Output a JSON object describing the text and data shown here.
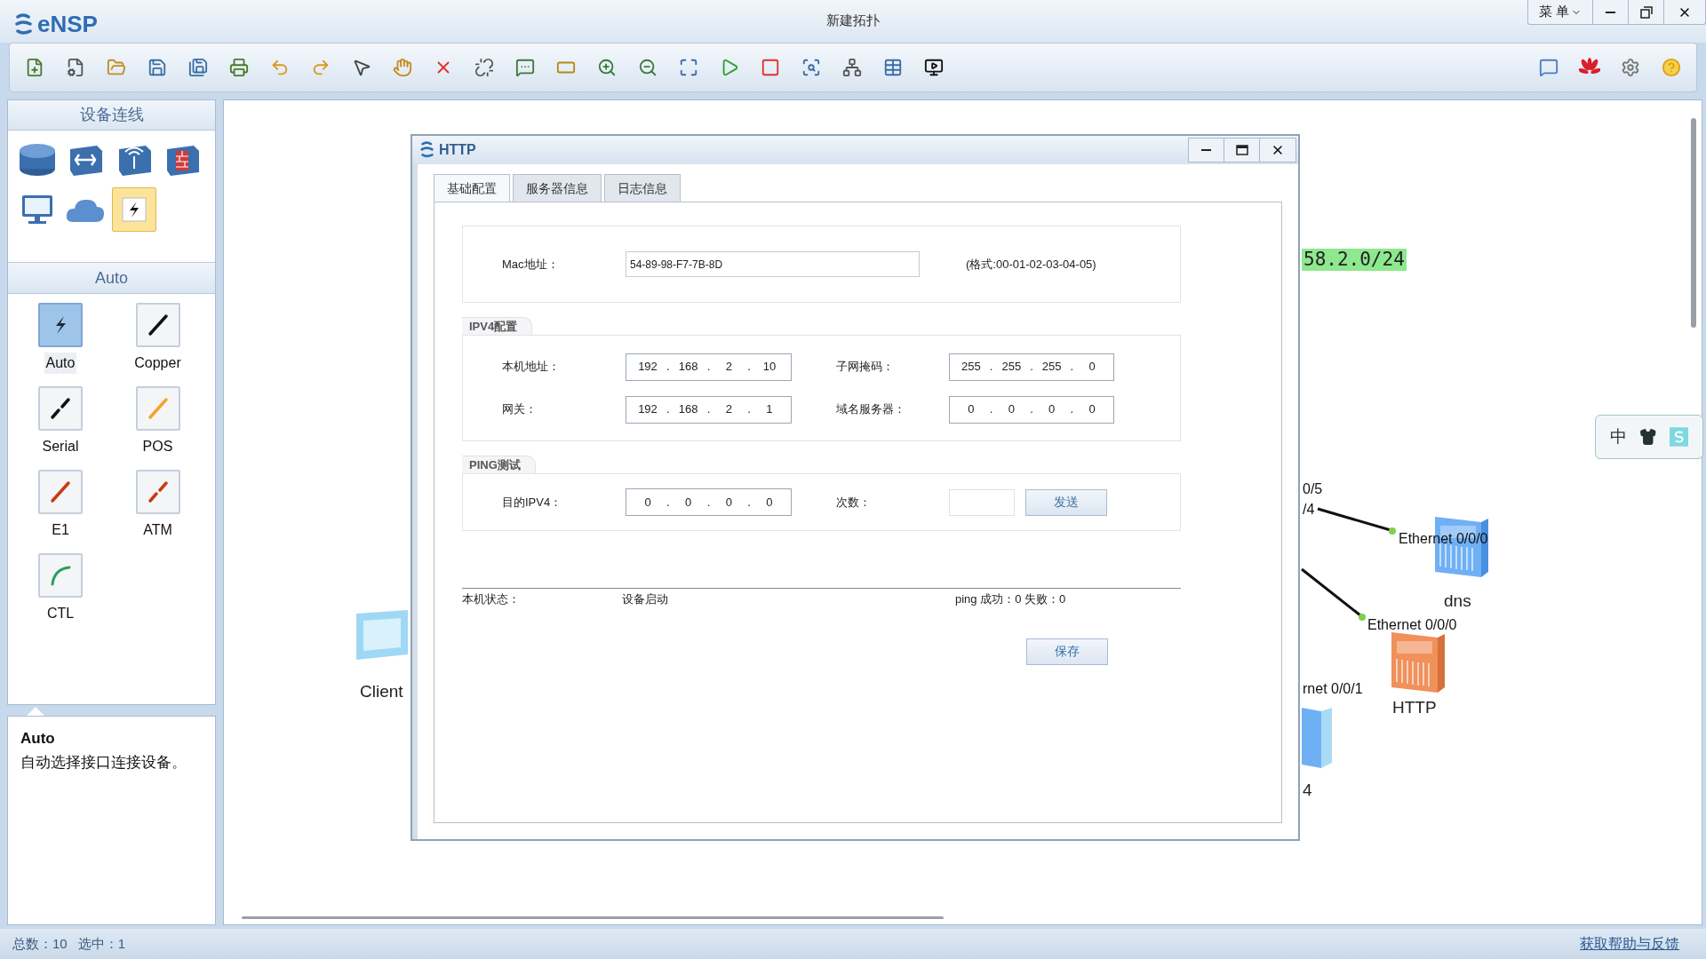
{
  "app": {
    "logo": "eNSP",
    "title": "新建拓扑",
    "menu_button": "菜 单"
  },
  "sidebar": {
    "devices_title": "设备连线",
    "devices": [
      {
        "kind": "router",
        "selected": false
      },
      {
        "kind": "switch",
        "selected": false
      },
      {
        "kind": "wireless",
        "selected": false
      },
      {
        "kind": "firewall",
        "selected": false
      },
      {
        "kind": "pc",
        "selected": false
      },
      {
        "kind": "cloud",
        "selected": false
      },
      {
        "kind": "link",
        "selected": true
      }
    ],
    "cables_title": "Auto",
    "cables": [
      {
        "label": "Auto",
        "kind": "auto",
        "selected": true
      },
      {
        "label": "Copper",
        "kind": "copper",
        "selected": false
      },
      {
        "label": "Serial",
        "kind": "serial",
        "selected": false
      },
      {
        "label": "POS",
        "kind": "pos",
        "selected": false
      },
      {
        "label": "E1",
        "kind": "e1",
        "selected": false
      },
      {
        "label": "ATM",
        "kind": "atm",
        "selected": false
      },
      {
        "label": "CTL",
        "kind": "ctl",
        "selected": false
      }
    ],
    "description": {
      "title": "Auto",
      "text": "自动选择接口连接设备。"
    }
  },
  "canvas": {
    "subnet_label": "58.2.0/24",
    "nodes": [
      {
        "kind": "client",
        "label": "Client"
      },
      {
        "kind": "dns-server",
        "label": "dns"
      },
      {
        "kind": "http-server",
        "label": "HTTP"
      },
      {
        "kind": "pc",
        "label": "4"
      }
    ],
    "port_labels": [
      "0/5",
      "/4",
      "Ethernet 0/0/0",
      "Ethernet 0/0/0",
      "rnet 0/0/1"
    ]
  },
  "ime_toolbar": {
    "mode": "中"
  },
  "dialog": {
    "title": "HTTP",
    "ip_separator": ".",
    "tabs": [
      {
        "label": "基础配置",
        "selected": true
      },
      {
        "label": "服务器信息",
        "selected": false
      },
      {
        "label": "日志信息",
        "selected": false
      }
    ],
    "mac": {
      "label": "Mac地址：",
      "value": "54-89-98-F7-7B-8D",
      "hint": "(格式:00-01-02-03-04-05)"
    },
    "ipv4": {
      "title": "IPV4配置",
      "fields": [
        {
          "label": "本机地址：",
          "octets": [
            "192",
            "168",
            "2",
            "10"
          ]
        },
        {
          "label": "子网掩码：",
          "octets": [
            "255",
            "255",
            "255",
            "0"
          ]
        },
        {
          "label": "网关：",
          "octets": [
            "192",
            "168",
            "2",
            "1"
          ]
        },
        {
          "label": "域名服务器：",
          "octets": [
            "0",
            "0",
            "0",
            "0"
          ]
        }
      ]
    },
    "ping": {
      "title": "PING测试",
      "target": {
        "label": "目的IPV4：",
        "octets": [
          "0",
          "0",
          "0",
          "0"
        ]
      },
      "count_label": "次数：",
      "send_button": "发送"
    },
    "status": {
      "label": "本机状态：",
      "value": "设备启动",
      "ping_result": "ping 成功：0 失败：0"
    },
    "save_button": "保存"
  },
  "status_bar": {
    "total": "总数：10",
    "selected_count": "选中：1",
    "help_link": "获取帮助与反馈"
  }
}
